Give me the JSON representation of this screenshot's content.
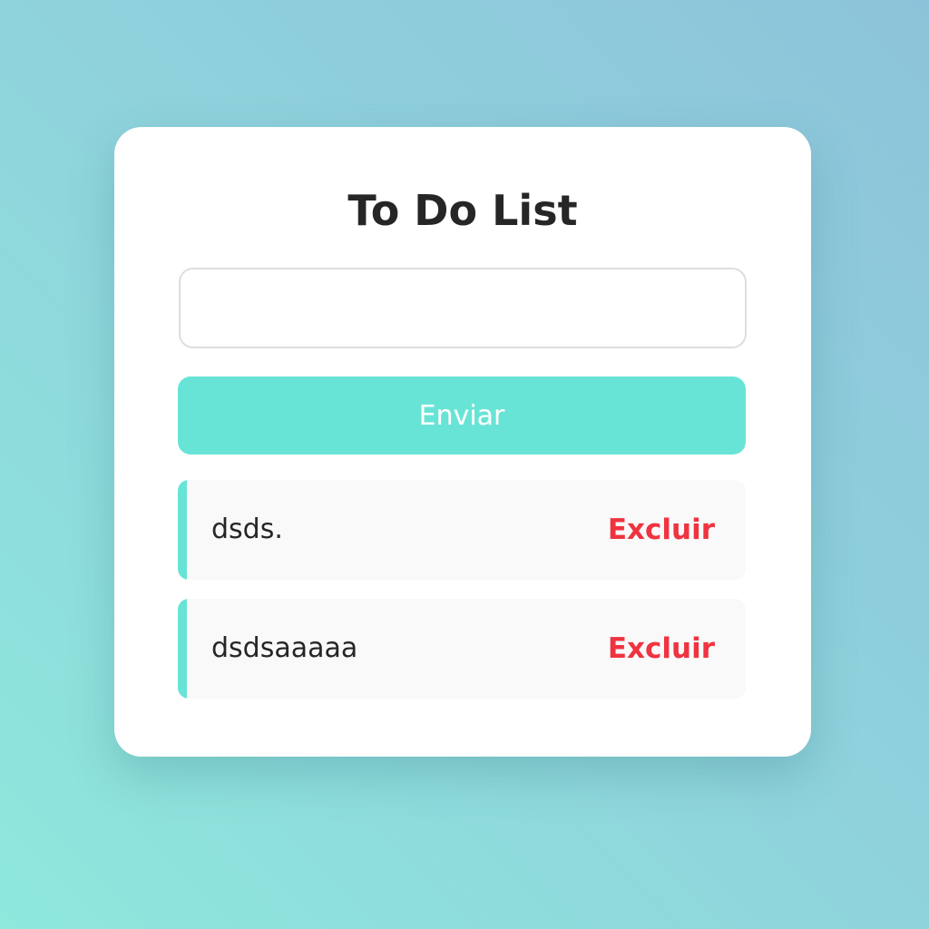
{
  "app": {
    "title": "To Do List"
  },
  "input": {
    "value": "",
    "placeholder": ""
  },
  "submit": {
    "label": "Enviar"
  },
  "tasks": [
    {
      "text": "dsds",
      "suffix": ".",
      "completed": true,
      "delete_label": "Excluir"
    },
    {
      "text": "dsdsaaaaa",
      "suffix": "",
      "completed": false,
      "delete_label": "Excluir"
    }
  ],
  "colors": {
    "accent": "#68e4d6",
    "delete": "#ef3340",
    "text": "#262626"
  }
}
